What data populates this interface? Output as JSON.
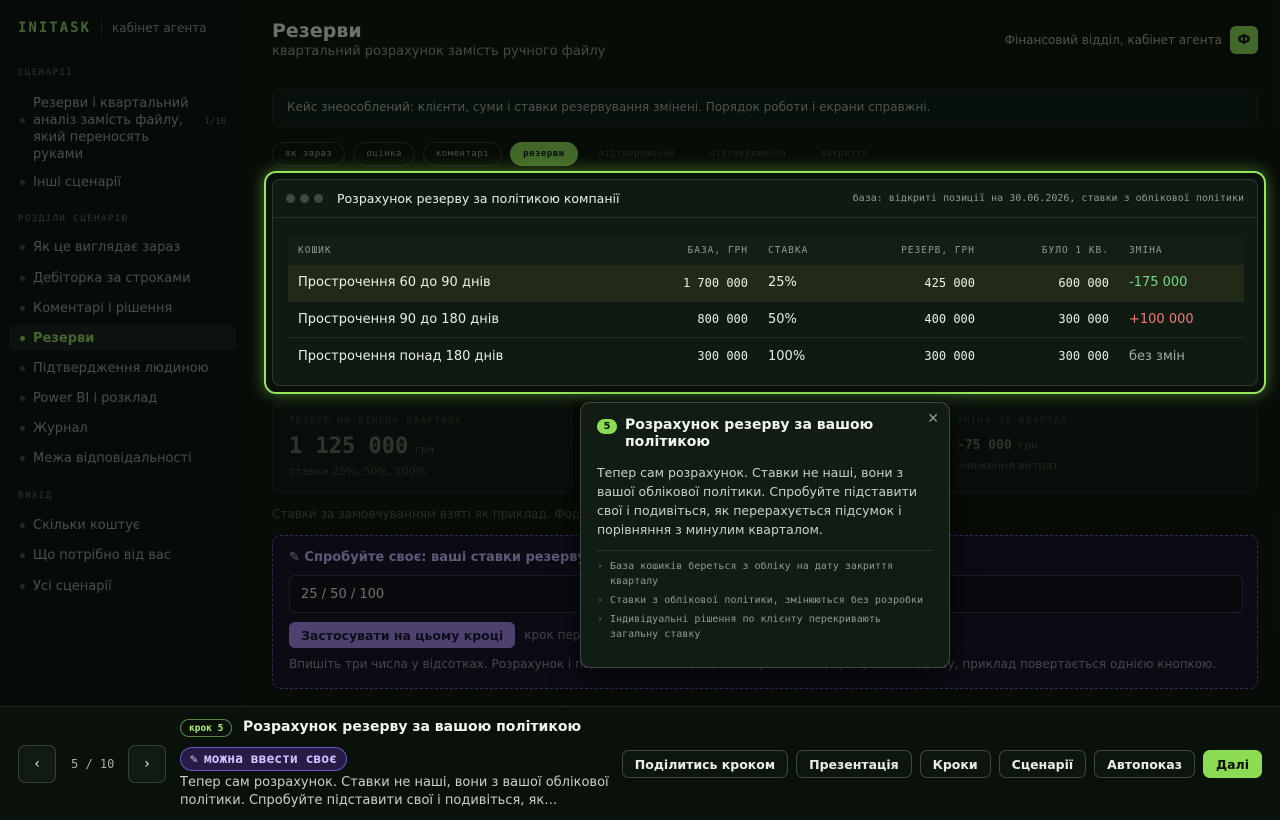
{
  "brand": {
    "logo": "INITASK",
    "subtitle": "кабінет агента"
  },
  "sidebar": {
    "section_scenario": "СЦЕНАРІЇ",
    "scenarios": [
      {
        "label": "Резерви і квартальний аналіз замість файлу, який переносять руками",
        "count": "1/10"
      },
      {
        "label": "Інші сценарії"
      }
    ],
    "section_steps": "РОЗДІЛИ СЦЕНАРІЮ",
    "steps": [
      "Як це виглядає зараз",
      "Дебіторка за строками",
      "Коментарі і рішення",
      "Резерви",
      "Підтвердження людиною",
      "Power BI і розклад",
      "Журнал",
      "Межа відповідальності"
    ],
    "section_more": "ВИХІД",
    "more": [
      "Скільки коштує",
      "Що потрібно від вас",
      "Усі сценарії"
    ]
  },
  "header": {
    "title": "Резерви",
    "subtitle": "квартальний розрахунок замість ручного файлу",
    "user": "Фінансовий відділ, кабінет агента",
    "avatar": "Ф"
  },
  "notice": "Кейс знеособлений: клієнти, суми і ставки резервування змінені. Порядок роботи і екрани справжні.",
  "tabs": [
    "як зараз",
    "оцінка",
    "коментарі",
    "резерви",
    "підтвердження",
    "підтвердження",
    "закриття"
  ],
  "table_card": {
    "title": "Розрахунок резерву за політикою компанії",
    "meta": "база: відкриті позиції на 30.06.2026, ставки з облікової політики",
    "columns": [
      "КОШИК",
      "БАЗА, ГРН",
      "СТАВКА",
      "РЕЗЕРВ, ГРН",
      "БУЛО 1 КВ.",
      "ЗМІНА"
    ],
    "rows": [
      {
        "bucket": "Прострочення 60 до 90 днів",
        "base": "1 700 000",
        "rate": "25%",
        "reserve": "425 000",
        "prev": "600 000",
        "change": "-175 000"
      },
      {
        "bucket": "Прострочення 90 до 180 днів",
        "base": "800 000",
        "rate": "50%",
        "reserve": "400 000",
        "prev": "300 000",
        "change": "+100 000"
      },
      {
        "bucket": "Прострочення понад 180 днів",
        "base": "300 000",
        "rate": "100%",
        "reserve": "300 000",
        "prev": "300 000",
        "change": "без змін"
      }
    ]
  },
  "stats": [
    {
      "label": "РЕЗЕРВ НА КІНЕЦЬ КВАРТАЛУ",
      "value": "1 125 000",
      "unit": "грн",
      "sub": "ставки 25%, 50%, 100%"
    },
    {
      "label": "ЗМІНА ЗА КВАРТАЛ",
      "value": "-75 000",
      "unit": "грн",
      "sub": "зниження витрат"
    }
  ],
  "note": "Ставки за замовчуванням взяті як приклад. Формула",
  "try_panel": {
    "title": "✎ Спробуйте своє: ваші ставки резервування",
    "input_value": "25 / 50 / 100",
    "apply": "Застосувати на цьому кроці",
    "hint": "крок переб",
    "desc": "Впишіть три числа у відсотках. Розрахунок і порівняння з попереднім кварталом перерахуються одразу, приклад повертається однією кнопкою."
  },
  "popover": {
    "num": "5",
    "title": "Розрахунок резерву за вашою політикою",
    "close": "✕",
    "body": "Тепер сам розрахунок. Ставки не наші, вони з вашої облікової політики. Спробуйте підставити свої і подивіться, як перерахується підсумок і порівняння з минулим кварталом.",
    "bullets": [
      "База кошиків береться з обліку на дату закриття кварталу",
      "Ставки з облікової політики, змінюються без розробки",
      "Індивідуальні рішення по клієнту перекривають загальну ставку"
    ]
  },
  "bottom": {
    "prev": "‹",
    "next": "›",
    "counter": "5 / 10",
    "step_tag": "крок 5",
    "step_title": "Розрахунок резерву за вашою політикою",
    "can_tag": "можна ввести своє",
    "step_desc": "Тепер сам розрахунок. Ставки не наші, вони з вашої облікової політики. Спробуйте підставити свої і подивіться, як…",
    "actions": [
      "Поділитись кроком",
      "Презентація",
      "Кроки",
      "Сценарії",
      "Автопоказ"
    ],
    "next_label": "Далі"
  }
}
